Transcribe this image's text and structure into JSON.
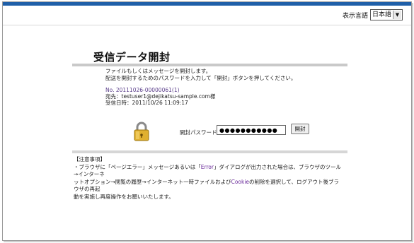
{
  "header": {
    "lang_label": "表示言語",
    "lang_value": "日本語"
  },
  "page": {
    "title": "受信データ開封",
    "description_1": "ファイルもしくはメッセージを開封します。",
    "description_2": "配送を開封するためのパスワードを入力して「開封」ボタンを押してください。"
  },
  "info": {
    "number": "No. 20111026-00000061(1)",
    "to_label": "宛先",
    "to_value": "testuser1@dejikatsu-sample.com様",
    "received_label": "受信日時",
    "received_value": "2011/10/26 11:09:17"
  },
  "form": {
    "password_label": "開封パスワード",
    "password_value": "●●●●●●●●●●●",
    "open_button": "開封",
    "lock_icon": "padlock-icon"
  },
  "notes": {
    "title": "【注意事項】",
    "line_1_a": "・ブラウザに「ページエラー」メッセージあるいは「",
    "line_1_b": "Error",
    "line_1_c": "」ダイアログが出力された場合は、ブラウザのツール→インターネ",
    "line_2_a": "ットオプション→閲覧の履歴→インターネット一時ファイルおよび",
    "line_2_b": "Cookie",
    "line_2_c": "の削除を選択して、ログアウト後ブラウザの再起",
    "line_3": "動を実施し再度操作をお願いいたします。"
  },
  "colors": {
    "topbar": "#1f5fa8",
    "link": "#5a3e8a"
  }
}
